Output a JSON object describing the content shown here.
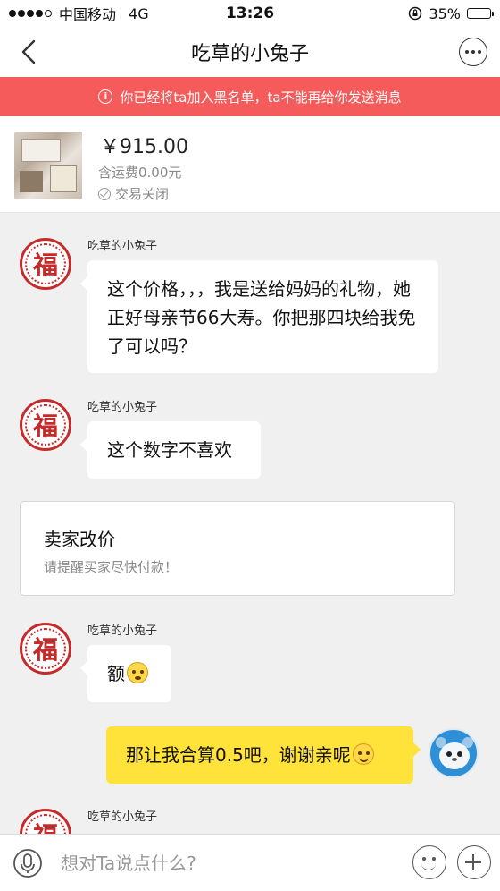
{
  "status_bar": {
    "carrier": "中国移动",
    "network": "4G",
    "time": "13:26",
    "battery": "35%",
    "battery_level": 0.35
  },
  "nav": {
    "title": "吃草的小兔子"
  },
  "banner": {
    "text": "你已经将ta加入黑名单，ta不能再给你发送消息",
    "color": "#f55b5b"
  },
  "product": {
    "price": "￥915.00",
    "shipping": "含运费0.00元",
    "status": "交易关闭"
  },
  "messages": [
    {
      "sender": "吃草的小兔子",
      "avatar_text": "福",
      "text": "这个价格，，，我是送给妈妈的礼物，她正好母亲节66大寿。你把那四块给我免了可以吗？"
    },
    {
      "sender": "吃草的小兔子",
      "avatar_text": "福",
      "text": "这个数字不喜欢"
    },
    {
      "sender": "吃草的小兔子",
      "avatar_text": "福",
      "text": "额",
      "emoji": "sweat-emoji"
    },
    {
      "sender": "me",
      "text": "那让我合算0.5吧，谢谢亲呢",
      "emoji": "smile-emoji"
    },
    {
      "sender": "吃草的小兔子",
      "avatar_text": "福"
    }
  ],
  "price_card": {
    "title": "卖家改价",
    "subtitle": "请提醒买家尽快付款！"
  },
  "input": {
    "placeholder": "想对Ta说点什么?"
  },
  "colors": {
    "bubble_self": "#ffe23a",
    "accent_red": "#c62a2a"
  }
}
